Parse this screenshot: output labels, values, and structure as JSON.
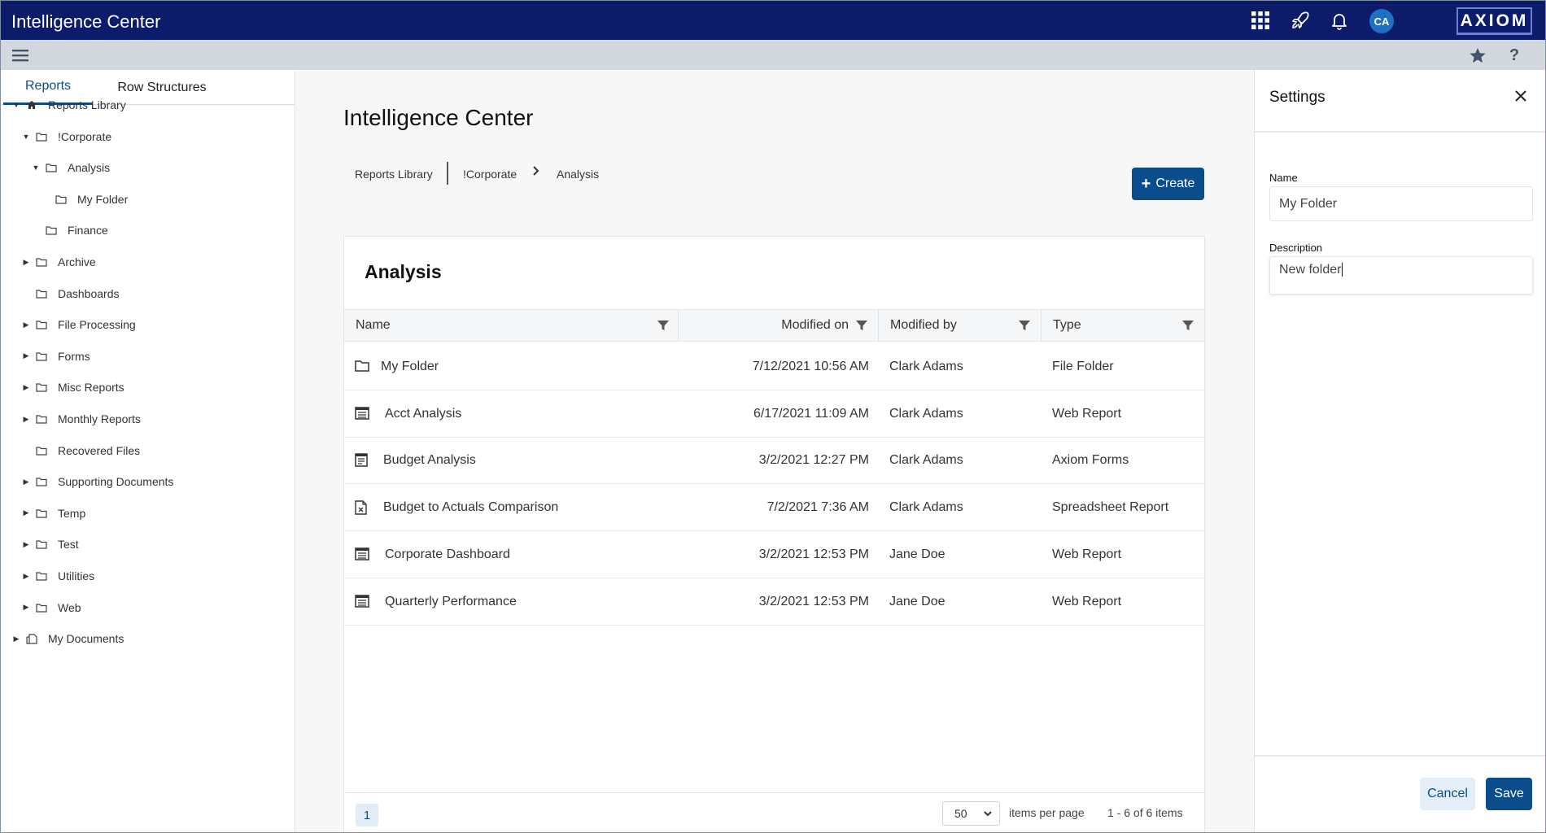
{
  "header": {
    "app_title": "Intelligence Center",
    "avatar_initials": "CA",
    "brand": "AXIOM"
  },
  "sidebar": {
    "tabs": [
      {
        "label": "Reports",
        "active": true
      },
      {
        "label": "Row Structures",
        "active": false
      }
    ],
    "tree": [
      {
        "label": "Reports Library",
        "icon": "home-icon",
        "caret": "expanded"
      },
      {
        "label": "!Corporate",
        "icon": "folder-icon",
        "caret": "expanded"
      },
      {
        "label": "Analysis",
        "icon": "folder-icon",
        "caret": "expanded"
      },
      {
        "label": "My Folder",
        "icon": "folder-icon",
        "caret": "none"
      },
      {
        "label": "Finance",
        "icon": "folder-icon",
        "caret": "none"
      },
      {
        "label": "Archive",
        "icon": "folder-icon",
        "caret": "collapsed"
      },
      {
        "label": "Dashboards",
        "icon": "folder-icon",
        "caret": "none"
      },
      {
        "label": "File Processing",
        "icon": "folder-icon",
        "caret": "collapsed"
      },
      {
        "label": "Forms",
        "icon": "folder-icon",
        "caret": "collapsed"
      },
      {
        "label": "Misc Reports",
        "icon": "folder-icon",
        "caret": "collapsed"
      },
      {
        "label": "Monthly Reports",
        "icon": "folder-icon",
        "caret": "collapsed"
      },
      {
        "label": "Recovered Files",
        "icon": "folder-icon",
        "caret": "none"
      },
      {
        "label": "Supporting Documents",
        "icon": "folder-icon",
        "caret": "collapsed"
      },
      {
        "label": "Temp",
        "icon": "folder-icon",
        "caret": "collapsed"
      },
      {
        "label": "Test",
        "icon": "folder-icon",
        "caret": "collapsed"
      },
      {
        "label": "Utilities",
        "icon": "folder-icon",
        "caret": "collapsed"
      },
      {
        "label": "Web",
        "icon": "folder-icon",
        "caret": "collapsed"
      },
      {
        "label": "My Documents",
        "icon": "documents-icon",
        "caret": "collapsed"
      }
    ]
  },
  "main": {
    "page_title": "Intelligence Center",
    "breadcrumb": [
      "Reports Library",
      "!Corporate",
      "Analysis"
    ],
    "create_label": "Create",
    "card_title": "Analysis",
    "columns": [
      "Name",
      "Modified on",
      "Modified by",
      "Type"
    ],
    "rows": [
      {
        "name": "My Folder",
        "modified_on": "7/12/2021 10:56 AM",
        "modified_by": "Clark Adams",
        "type": "File Folder",
        "icon": "folder-icon"
      },
      {
        "name": "Acct Analysis",
        "modified_on": "6/17/2021 11:09 AM",
        "modified_by": "Clark Adams",
        "type": "Web Report",
        "icon": "web-report-icon"
      },
      {
        "name": "Budget Analysis",
        "modified_on": "3/2/2021 12:27 PM",
        "modified_by": "Clark Adams",
        "type": "Axiom Forms",
        "icon": "form-icon"
      },
      {
        "name": "Budget to Actuals Comparison",
        "modified_on": "7/2/2021 7:36 AM",
        "modified_by": "Clark Adams",
        "type": "Spreadsheet Report",
        "icon": "spreadsheet-icon"
      },
      {
        "name": "Corporate Dashboard",
        "modified_on": "3/2/2021 12:53 PM",
        "modified_by": "Jane Doe",
        "type": "Web Report",
        "icon": "web-report-icon"
      },
      {
        "name": "Quarterly Performance",
        "modified_on": "3/2/2021 12:53 PM",
        "modified_by": "Jane Doe",
        "type": "Web Report",
        "icon": "web-report-icon"
      }
    ],
    "pager": {
      "current_page": "1",
      "page_size": "50",
      "items_per_page_label": "items per page",
      "summary": "1 - 6 of 6 items"
    }
  },
  "settings": {
    "title": "Settings",
    "name_label": "Name",
    "name_value": "My Folder",
    "description_label": "Description",
    "description_value": "New folder",
    "cancel_label": "Cancel",
    "save_label": "Save"
  },
  "colors": {
    "topbar": "#0c1c6b",
    "subbar": "#d3d8df",
    "accent": "#0b4c8c",
    "avatar": "#1f6fc4"
  }
}
